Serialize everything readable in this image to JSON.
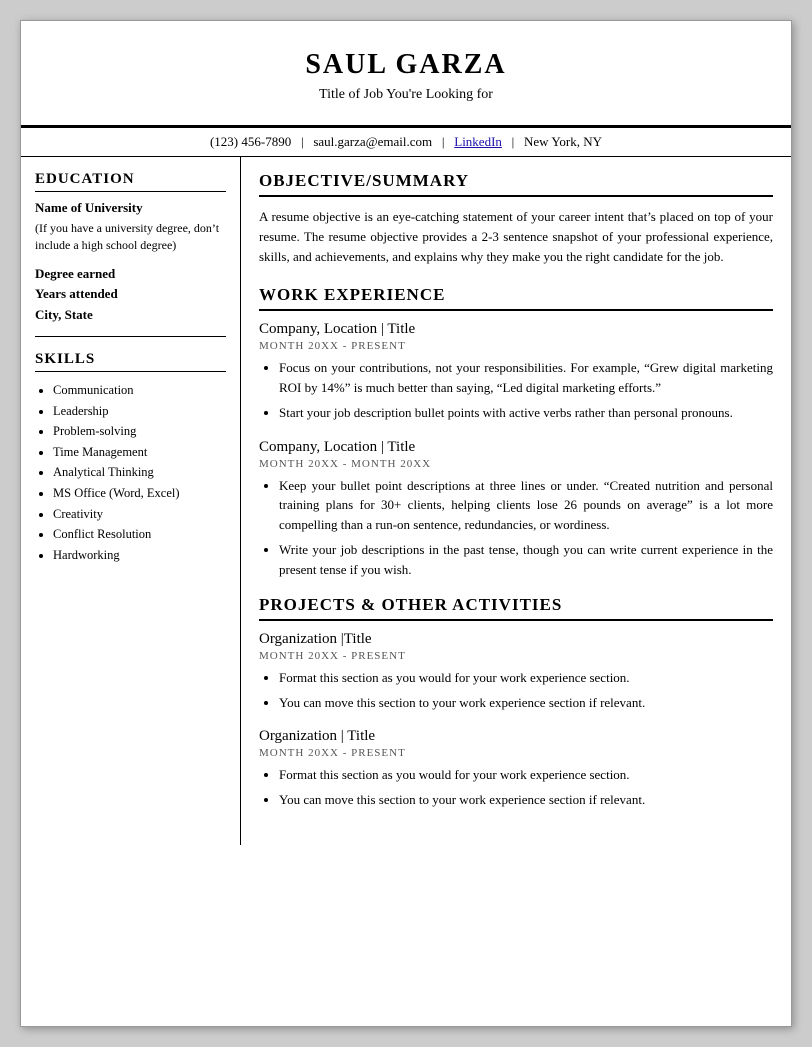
{
  "header": {
    "name": "SAUL GARZA",
    "title": "Title of Job You're Looking for",
    "phone": "(123) 456-7890",
    "email": "saul.garza@email.com",
    "linkedin_text": "LinkedIn",
    "linkedin_href": "#",
    "location": "New York, NY"
  },
  "education": {
    "section_label": "EDUCATION",
    "university": "Name of University",
    "university_note": "(If you have a university degree, don’t include a high school degree)",
    "degree": "Degree earned",
    "years": "Years attended",
    "city": "City, State"
  },
  "skills": {
    "section_label": "SKILLS",
    "items": [
      "Communication",
      "Leadership",
      "Problem-solving",
      "Time Management",
      "Analytical Thinking",
      "MS Office (Word, Excel)",
      "Creativity",
      "Conflict Resolution",
      "Hardworking"
    ]
  },
  "objective": {
    "section_label": "OBJECTIVE/SUMMARY",
    "text": "A resume objective is an eye-catching statement of your career intent that’s placed on top of your resume. The resume objective provides a 2-3 sentence snapshot of your professional experience, skills, and achievements, and explains why they make you the right candidate for the job."
  },
  "work_experience": {
    "section_label": "WORK EXPERIENCE",
    "jobs": [
      {
        "company": "Company, Location | Title",
        "dates": "MONTH 20XX - PRESENT",
        "bullets": [
          "Focus on your contributions, not your responsibilities. For example, “Grew digital marketing ROI by 14%” is much better than saying, “Led digital marketing efforts.”",
          "Start your job description bullet points with active verbs rather than personal pronouns."
        ]
      },
      {
        "company": "Company, Location | Title",
        "dates": "MONTH 20XX -  MONTH 20XX",
        "bullets": [
          "Keep your bullet point descriptions at three lines or under. “Created nutrition and personal training plans for 30+ clients, helping clients lose 26 pounds on average” is a lot more compelling than a run-on sentence, redundancies, or wordiness.",
          "Write your job descriptions in the past tense, though you can write current experience in the present tense if you wish."
        ]
      }
    ]
  },
  "projects": {
    "section_label": "PROJECTS & OTHER ACTIVITIES",
    "orgs": [
      {
        "title": "Organization |Title",
        "dates": "MONTH 20XX - PRESENT",
        "bullets": [
          "Format this section as you would for your work experience section.",
          "You can move this section to your work experience section if relevant."
        ]
      },
      {
        "title": "Organization | Title",
        "dates": "MONTH 20XX - PRESENT",
        "bullets": [
          "Format this section as you would for your work experience section.",
          "You can move this section to your work experience section if relevant."
        ]
      }
    ]
  }
}
